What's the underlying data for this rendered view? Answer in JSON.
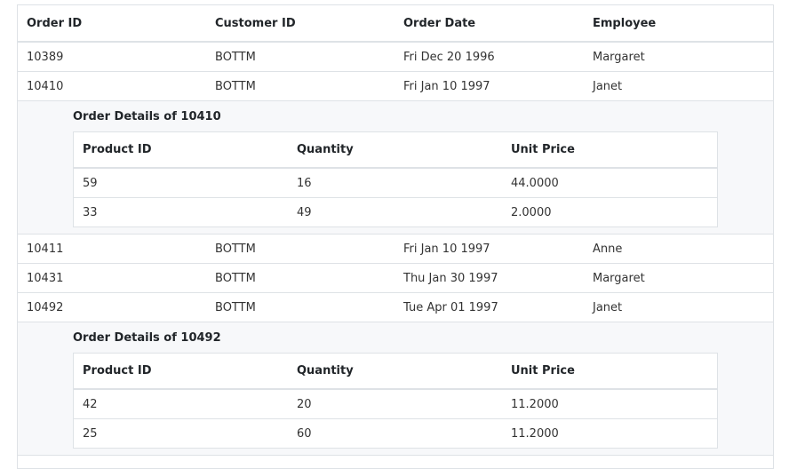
{
  "headers": [
    "Order ID",
    "Customer ID",
    "Order Date",
    "Employee"
  ],
  "orders": [
    {
      "order_id": "10389",
      "customer_id": "BOTTM",
      "order_date": "Fri Dec 20 1996",
      "employee": "Margaret"
    },
    {
      "order_id": "10410",
      "customer_id": "BOTTM",
      "order_date": "Fri Jan 10 1997",
      "employee": "Janet"
    },
    {
      "order_id": "10411",
      "customer_id": "BOTTM",
      "order_date": "Fri Jan 10 1997",
      "employee": "Anne"
    },
    {
      "order_id": "10431",
      "customer_id": "BOTTM",
      "order_date": "Thu Jan 30 1997",
      "employee": "Margaret"
    },
    {
      "order_id": "10492",
      "customer_id": "BOTTM",
      "order_date": "Tue Apr 01 1997",
      "employee": "Janet"
    }
  ],
  "details": [
    {
      "title": "Order Details of 10410",
      "headers": [
        "Product ID",
        "Quantity",
        "Unit Price"
      ],
      "rows": [
        {
          "product_id": "59",
          "quantity": "16",
          "unit_price": "44.0000"
        },
        {
          "product_id": "33",
          "quantity": "49",
          "unit_price": "2.0000"
        }
      ]
    },
    {
      "title": "Order Details of 10492",
      "headers": [
        "Product ID",
        "Quantity",
        "Unit Price"
      ],
      "rows": [
        {
          "product_id": "42",
          "quantity": "20",
          "unit_price": "11.2000"
        },
        {
          "product_id": "25",
          "quantity": "60",
          "unit_price": "11.2000"
        }
      ]
    }
  ]
}
